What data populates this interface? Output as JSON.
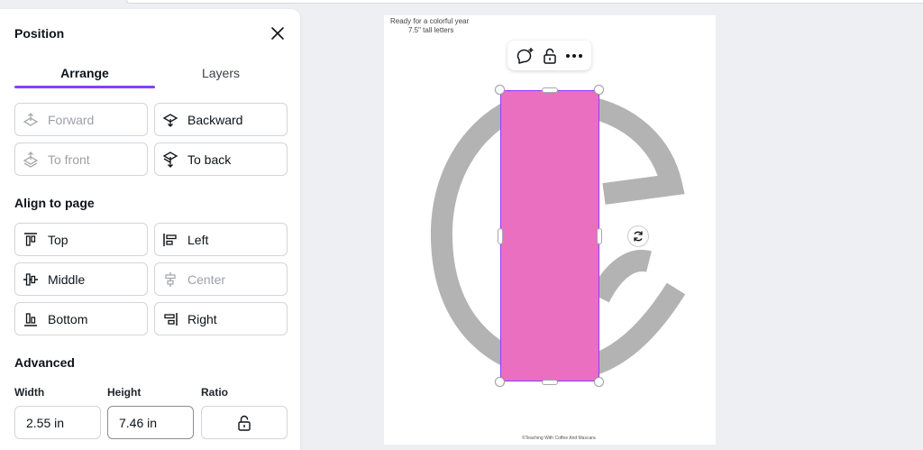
{
  "panel": {
    "title": "Position",
    "tabs": [
      {
        "label": "Arrange",
        "active": true
      },
      {
        "label": "Layers",
        "active": false
      }
    ],
    "arrange_buttons": [
      {
        "label": "Forward",
        "enabled": false,
        "icon": "forward-icon"
      },
      {
        "label": "Backward",
        "enabled": true,
        "icon": "backward-icon"
      },
      {
        "label": "To front",
        "enabled": false,
        "icon": "to-front-icon"
      },
      {
        "label": "To back",
        "enabled": true,
        "icon": "to-back-icon"
      }
    ],
    "align_title": "Align to page",
    "align_buttons": [
      {
        "label": "Top",
        "enabled": true,
        "icon": "align-top-icon"
      },
      {
        "label": "Left",
        "enabled": true,
        "icon": "align-left-icon"
      },
      {
        "label": "Middle",
        "enabled": true,
        "icon": "align-middle-icon"
      },
      {
        "label": "Center",
        "enabled": false,
        "icon": "align-center-icon"
      },
      {
        "label": "Bottom",
        "enabled": true,
        "icon": "align-bottom-icon"
      },
      {
        "label": "Right",
        "enabled": true,
        "icon": "align-right-icon"
      }
    ],
    "advanced_title": "Advanced",
    "width_label": "Width",
    "width_value": "2.55 in",
    "height_label": "Height",
    "height_value": "7.46 in",
    "ratio_label": "Ratio"
  },
  "canvas": {
    "note_line1": "Ready for a colorful year",
    "note_line2": "7.5\" tall letters",
    "footer": "©Teaching With Coffee And Mascara",
    "shape_color": "#ea6fc0",
    "letter_color": "#b3b3b3",
    "selection_color": "#8b3dff"
  },
  "accent": "#8b3dff"
}
